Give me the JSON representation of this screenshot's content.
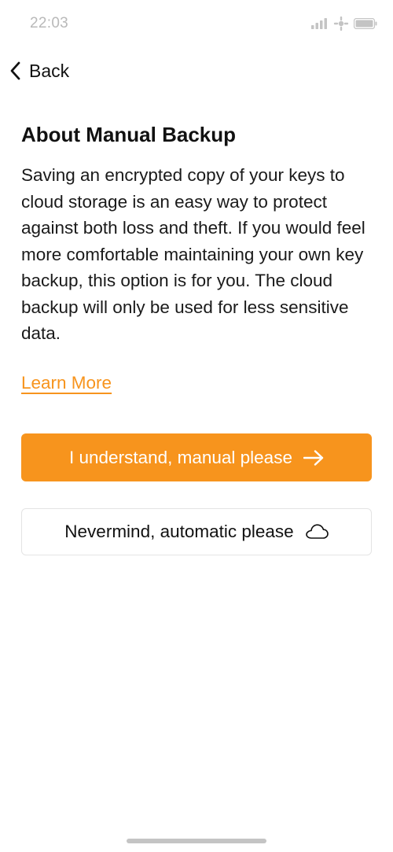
{
  "status_bar": {
    "time": "22:03",
    "icons": [
      "signal-icon",
      "wifi-icon",
      "battery-icon"
    ]
  },
  "nav": {
    "back_label": "Back",
    "back_icon": "chevron-left-icon"
  },
  "content": {
    "title": "About Manual Backup",
    "body": "Saving an encrypted copy of your keys to cloud storage is an easy way to protect against both loss and theft. If you would feel more comfortable maintaining your own key backup, this option is for you. The cloud backup will only be used for less sensitive data.",
    "learn_more": "Learn More"
  },
  "actions": {
    "primary_label": "I understand, manual please",
    "primary_icon": "arrow-right-icon",
    "secondary_label": "Nevermind, automatic please",
    "secondary_icon": "cloud-icon"
  },
  "colors": {
    "accent": "#F7941D",
    "text": "#111111",
    "muted": "#B9B9B9"
  }
}
